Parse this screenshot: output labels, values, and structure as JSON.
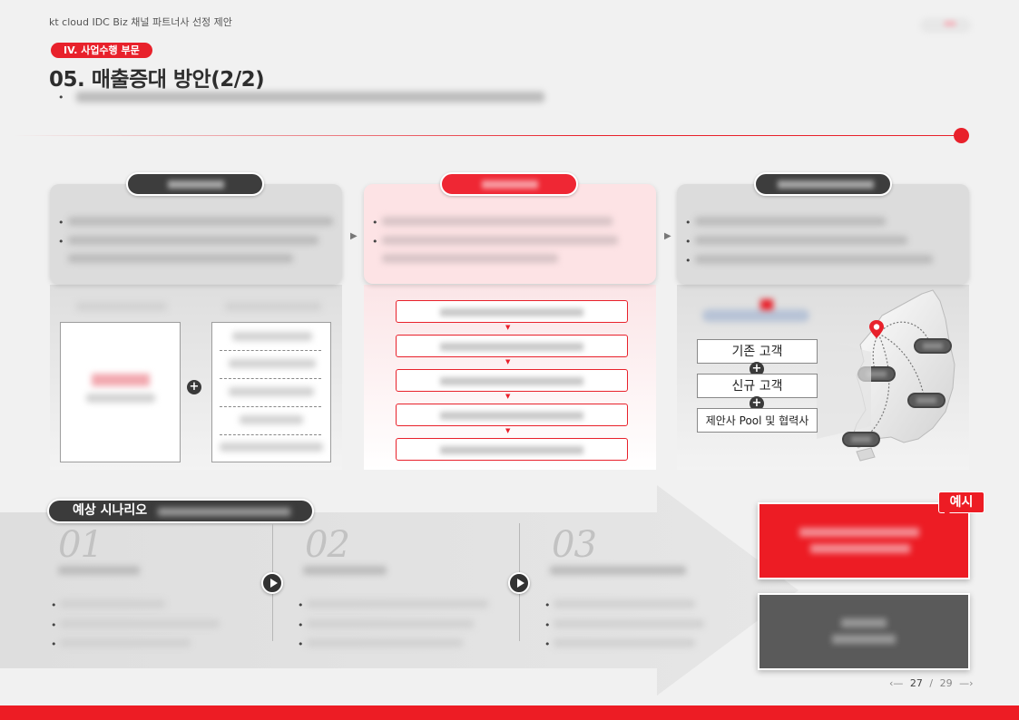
{
  "header": {
    "doc_title": "kt cloud IDC Biz 채널 파트너사 선정 제안",
    "section_label": "IV. 사업수행 부문",
    "page_title": "05. 매출증대 방안(2/2)"
  },
  "customers": {
    "existing": "기존 고객",
    "new": "신규 고객",
    "pool": "제안사 Pool 및 협력사",
    "plus_symbol": "+"
  },
  "scenario": {
    "label": "예상 시나리오",
    "steps": [
      {
        "number": "01"
      },
      {
        "number": "02"
      },
      {
        "number": "03"
      }
    ]
  },
  "example_tag": "예시",
  "pager": {
    "prev": "‹—",
    "current": "27",
    "separator": "/",
    "total": "29",
    "next": "—›"
  },
  "colors": {
    "accent": "#ed1c24",
    "dark": "#3b3b3b",
    "background": "#f1f1f1"
  },
  "icons": {
    "play": "play-circle-icon",
    "plus": "plus-circle-icon",
    "location": "map-pin-icon"
  }
}
